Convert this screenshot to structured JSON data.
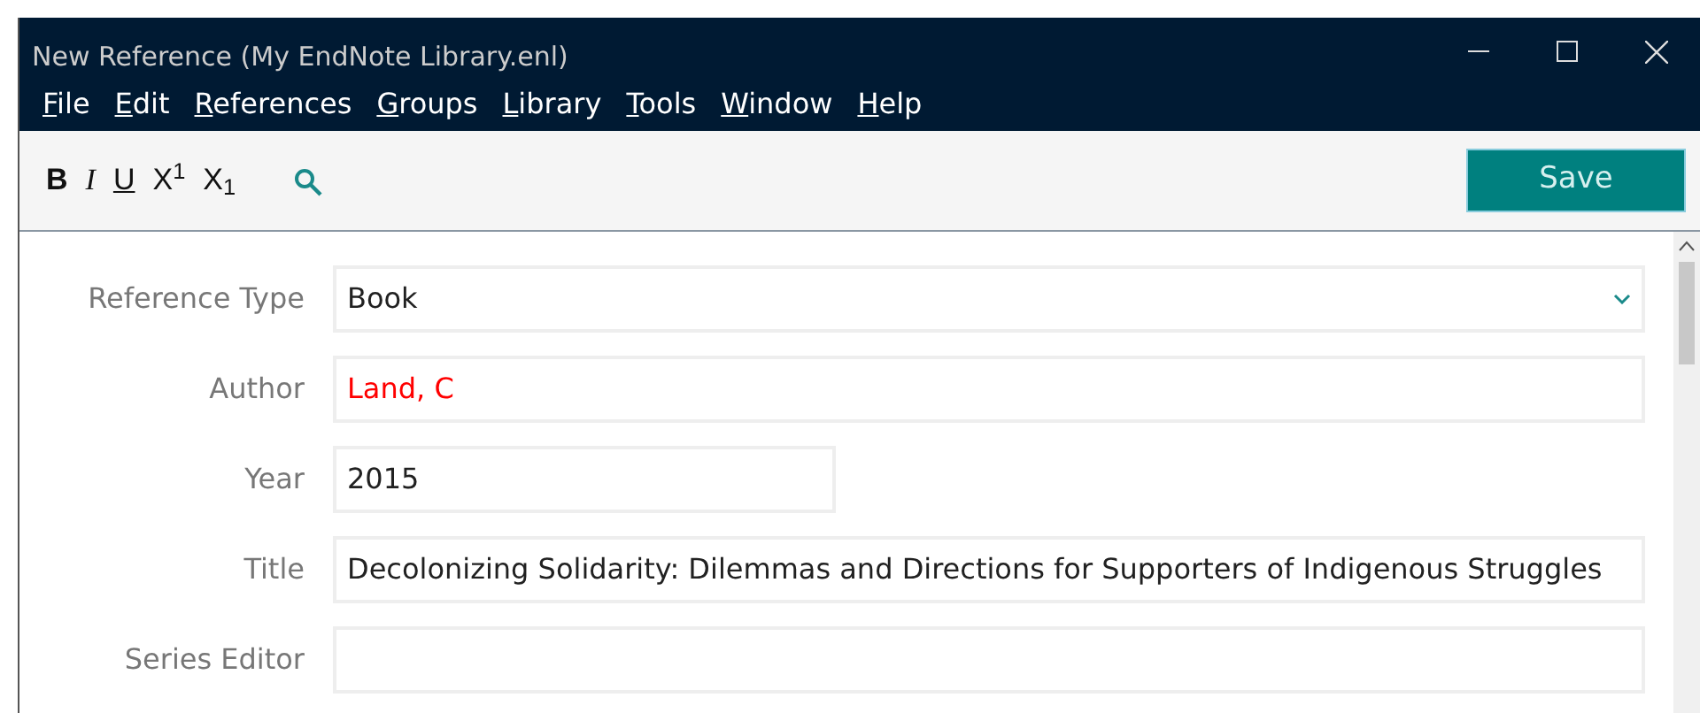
{
  "window": {
    "title": "New Reference (My EndNote Library.enl)"
  },
  "menu": [
    {
      "label": "File"
    },
    {
      "label": "Edit"
    },
    {
      "label": "References"
    },
    {
      "label": "Groups"
    },
    {
      "label": "Library"
    },
    {
      "label": "Tools"
    },
    {
      "label": "Window"
    },
    {
      "label": "Help"
    }
  ],
  "format_buttons": [
    {
      "kind": "bold",
      "label": "B"
    },
    {
      "kind": "italic",
      "label": "I"
    },
    {
      "kind": "underline",
      "label": "U"
    },
    {
      "kind": "plain",
      "label": "X$^{1}$"
    },
    {
      "kind": "plain",
      "label": "X$_{1}$"
    }
  ],
  "save_button": "Save",
  "fields": [
    {
      "label": "Reference Type",
      "kind": "dropdown",
      "value": "Book",
      "color": "#212121"
    },
    {
      "label": "Author",
      "kind": "text",
      "value": "Land, C",
      "color": "#ff0000"
    },
    {
      "label": "Year",
      "kind": "short",
      "value": "2015",
      "color": "#212121"
    },
    {
      "label": "Title",
      "kind": "text",
      "value": "Decolonizing Solidarity: Dilemmas and Directions for Supporters of Indigenous Struggles",
      "color": "#212121"
    },
    {
      "label": "Series Editor",
      "kind": "text"
    }
  ]
}
